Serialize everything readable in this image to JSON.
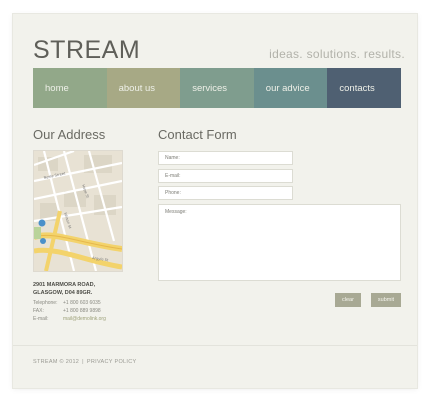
{
  "header": {
    "logo": "STREAM",
    "tagline": "ideas. solutions. results."
  },
  "nav": {
    "items": [
      {
        "label": "home",
        "color": "#92a889"
      },
      {
        "label": "about us",
        "color": "#a7a985"
      },
      {
        "label": "services",
        "color": "#7f9d8e"
      },
      {
        "label": "our advice",
        "color": "#6b8f8e"
      },
      {
        "label": "contacts",
        "color": "#4f6072"
      }
    ]
  },
  "address": {
    "title": "Our Address",
    "street": "2901 MARMORA ROAD,",
    "city": "GLASGOW, D04 89GR.",
    "telephone_label": "Telephone:",
    "telephone": "+1 800 603 6035",
    "fax_label": "FAX:",
    "fax": "+1 800 889 9898",
    "email_label": "E-mail:",
    "email": "mail@demolink.org"
  },
  "contact_form": {
    "title": "Contact Form",
    "name_placeholder": "Name:",
    "email_placeholder": "E-mail:",
    "phone_placeholder": "Phone:",
    "message_placeholder": "Message:",
    "clear_label": "clear",
    "submit_label": "submit",
    "button_color": "#a8a994"
  },
  "footer": {
    "brand": "STREAM © 2012",
    "separator": "|",
    "privacy": "PRIVACY POLICY"
  }
}
